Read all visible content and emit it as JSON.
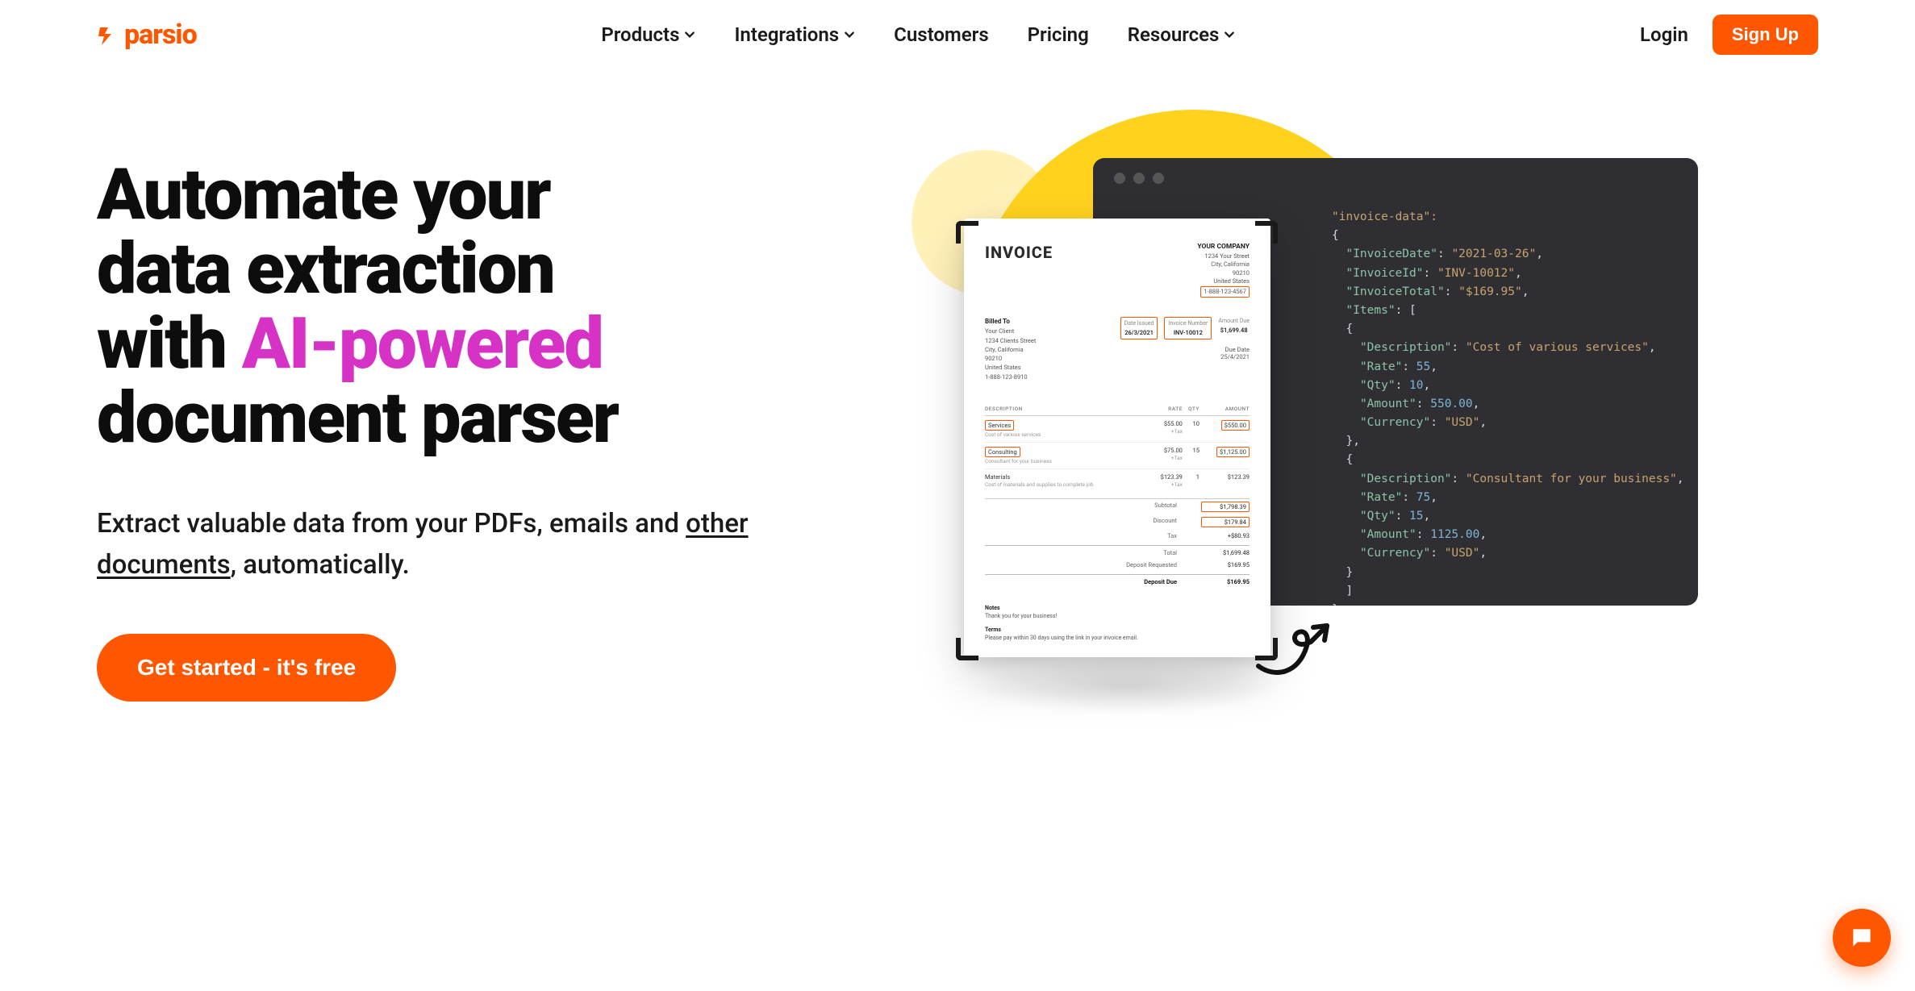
{
  "brand": {
    "name": "parsio"
  },
  "nav": {
    "items": [
      {
        "label": "Products",
        "hasMenu": true
      },
      {
        "label": "Integrations",
        "hasMenu": true
      },
      {
        "label": "Customers",
        "hasMenu": false
      },
      {
        "label": "Pricing",
        "hasMenu": false
      },
      {
        "label": "Resources",
        "hasMenu": true
      }
    ],
    "login": "Login",
    "signup": "Sign Up"
  },
  "hero": {
    "headline_1": "Automate your",
    "headline_2": "data extraction",
    "headline_3": "with ",
    "headline_accent": "AI-powered",
    "headline_4": "document parser",
    "sub_pre": "Extract valuable data from your PDFs, emails and ",
    "sub_link": "other documents",
    "sub_post": ", automatically.",
    "cta": "Get started - it's free"
  },
  "invoice": {
    "title": "INVOICE",
    "company": {
      "name": "YOUR COMPANY",
      "addr1": "1234 Your Street",
      "city": "City, California",
      "zip": "90210",
      "country": "United States",
      "phone": "1-888-123-4567"
    },
    "billed_label": "Billed To",
    "billed": {
      "name": "Your Client",
      "addr1": "1234 Clients Street",
      "city": "City, California",
      "zip": "90210",
      "country": "United States",
      "phone": "1-888-123-8910"
    },
    "date_issued_label": "Date Issued",
    "date_issued": "26/3/2021",
    "invoice_number_label": "Invoice Number",
    "invoice_number": "INV-10012",
    "amount_due_label": "Amount Due",
    "amount_due": "$1,699.48",
    "due_date_label": "Due Date",
    "due_date": "25/4/2021",
    "col_desc": "DESCRIPTION",
    "col_rate": "RATE",
    "col_qty": "QTY",
    "col_amount": "AMOUNT",
    "rows": [
      {
        "name": "Services",
        "sub": "Cost of various services",
        "rate": "$55.00",
        "rateSub": "+Tax",
        "qty": "10",
        "amount": "$550.00",
        "hl": true
      },
      {
        "name": "Consulting",
        "sub": "Consultant for your business",
        "rate": "$75.00",
        "rateSub": "+Tax",
        "qty": "15",
        "amount": "$1,125.00",
        "hl": true
      },
      {
        "name": "Materials",
        "sub": "Cost of materials and supplies to complete job",
        "rate": "$123.39",
        "rateSub": "+Tax",
        "qty": "1",
        "amount": "$123.39",
        "hl": false
      }
    ],
    "totals": {
      "subtotal_label": "Subtotal",
      "subtotal": "$1,798.39",
      "discount_label": "Discount",
      "discount": "$179.84",
      "tax_label": "Tax",
      "tax": "+$80.93",
      "total_label": "Total",
      "total": "$1,699.48",
      "deposit_label": "Deposit Requested",
      "deposit": "$169.95",
      "depdue_label": "Deposit Due",
      "depdue": "$169.95"
    },
    "notes_label": "Notes",
    "notes": "Thank you for your business!",
    "terms_label": "Terms",
    "terms": "Please pay within 30 days using the link in your invoice email."
  },
  "json_output": {
    "root": "\"invoice-data\":",
    "lines": [
      "{",
      "  \"InvoiceDate\": \"2021-03-26\",",
      "  \"InvoiceId\": \"INV-10012\",",
      "  \"InvoiceTotal\": \"$169.95\",",
      "  \"Items\": [",
      "  {",
      "    \"Description\": \"Cost of various services\",",
      "    \"Rate\": 55,",
      "    \"Qty\": 10,",
      "    \"Amount\": 550.00,",
      "    \"Currency\": \"USD\",",
      "  },",
      "  {",
      "    \"Description\": \"Consultant for your business\",",
      "    \"Rate\": 75,",
      "    \"Qty\": 15,",
      "    \"Amount\": 1125.00,",
      "    \"Currency\": \"USD\",",
      "  }",
      "  ]",
      "}"
    ]
  }
}
